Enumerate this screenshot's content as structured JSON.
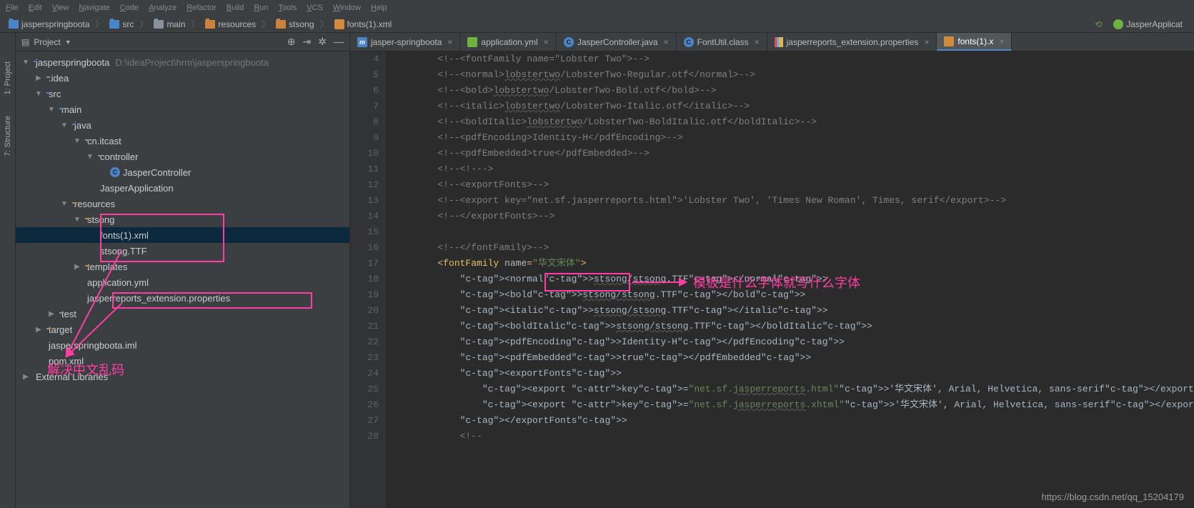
{
  "menu": [
    "File",
    "Edit",
    "View",
    "Navigate",
    "Code",
    "Analyze",
    "Refactor",
    "Build",
    "Run",
    "Tools",
    "VCS",
    "Window",
    "Help"
  ],
  "breadcrumbs": [
    {
      "label": "jasperspringboota",
      "icon": "folder-blue"
    },
    {
      "label": "src",
      "icon": "folder-blue"
    },
    {
      "label": "main",
      "icon": "folder"
    },
    {
      "label": "resources",
      "icon": "folder-orange"
    },
    {
      "label": "stsong",
      "icon": "folder-orange"
    },
    {
      "label": "fonts(1).xml",
      "icon": "xml"
    }
  ],
  "run_config": "JasperApplicat",
  "left_rail": [
    "1: Project",
    "7: Structure"
  ],
  "project_panel_title": "Project",
  "tree": [
    {
      "depth": 0,
      "exp": "▼",
      "icon": "folder-blue",
      "label": "jasperspringboota",
      "muted": "D:\\ideaProject\\hrm\\jasperspringboota"
    },
    {
      "depth": 1,
      "exp": "▶",
      "icon": "folder",
      "label": ".idea"
    },
    {
      "depth": 1,
      "exp": "▼",
      "icon": "folder-blue",
      "label": "src"
    },
    {
      "depth": 2,
      "exp": "▼",
      "icon": "folder-blue",
      "label": "main"
    },
    {
      "depth": 3,
      "exp": "▼",
      "icon": "folder-blue",
      "label": "java"
    },
    {
      "depth": 4,
      "exp": "▼",
      "icon": "folder",
      "label": "cn.itcast"
    },
    {
      "depth": 5,
      "exp": "▼",
      "icon": "folder",
      "label": "controller"
    },
    {
      "depth": 6,
      "exp": "",
      "icon": "class",
      "label": "JasperController"
    },
    {
      "depth": 5,
      "exp": "",
      "icon": "spring",
      "label": "JasperApplication"
    },
    {
      "depth": 3,
      "exp": "▼",
      "icon": "folder-orange",
      "label": "resources"
    },
    {
      "depth": 4,
      "exp": "▼",
      "icon": "folder-orange",
      "label": "stsong",
      "box": "b1"
    },
    {
      "depth": 5,
      "exp": "",
      "icon": "xml",
      "label": "fonts(1).xml",
      "selected": true,
      "box": "b1"
    },
    {
      "depth": 5,
      "exp": "",
      "icon": "file",
      "label": "stsong.TTF",
      "box": "b1"
    },
    {
      "depth": 4,
      "exp": "▶",
      "icon": "folder-orange",
      "label": "templates"
    },
    {
      "depth": 4,
      "exp": "",
      "icon": "yml",
      "label": "application.yml"
    },
    {
      "depth": 4,
      "exp": "",
      "icon": "props",
      "label": "jasperreports_extension.properties",
      "box": "b2"
    },
    {
      "depth": 2,
      "exp": "▶",
      "icon": "folder",
      "label": "test"
    },
    {
      "depth": 1,
      "exp": "▶",
      "icon": "folder-orange",
      "label": "target"
    },
    {
      "depth": 1,
      "exp": "",
      "icon": "iml",
      "label": "jasperspringboota.iml"
    },
    {
      "depth": 1,
      "exp": "",
      "icon": "xml",
      "label": "pom.xml"
    },
    {
      "depth": 0,
      "exp": "▶",
      "icon": "extlib",
      "label": "External Libraries"
    }
  ],
  "tabs": [
    {
      "label": "jasper-springboota",
      "icon": "m",
      "active": false
    },
    {
      "label": "application.yml",
      "icon": "yml",
      "active": false
    },
    {
      "label": "JasperController.java",
      "icon": "class",
      "active": false
    },
    {
      "label": "FontUtil.class",
      "icon": "class",
      "active": false
    },
    {
      "label": "jasperreports_extension.properties",
      "icon": "props",
      "active": false
    },
    {
      "label": "fonts(1).x",
      "icon": "xml",
      "active": true
    }
  ],
  "code_start_line": 4,
  "code_lines": [
    {
      "t": "comment",
      "text": "<!--<fontFamily name=\"Lobster Two\">-->"
    },
    {
      "t": "comment",
      "text": "<!--<normal>lobstertwo/LobsterTwo-Regular.otf</normal>-->",
      "u": "lobstertwo"
    },
    {
      "t": "comment",
      "text": "<!--<bold>lobstertwo/LobsterTwo-Bold.otf</bold>-->",
      "u": "lobstertwo"
    },
    {
      "t": "comment",
      "text": "<!--<italic>lobstertwo/LobsterTwo-Italic.otf</italic>-->",
      "u": "lobstertwo"
    },
    {
      "t": "comment",
      "text": "<!--<boldItalic>lobstertwo/LobsterTwo-BoldItalic.otf</boldItalic>-->",
      "u": "lobstertwo"
    },
    {
      "t": "comment",
      "text": "<!--<pdfEncoding>Identity-H</pdfEncoding>-->"
    },
    {
      "t": "comment",
      "text": "<!--<pdfEmbedded>true</pdfEmbedded>-->"
    },
    {
      "t": "comment",
      "text": "<!--<!--->"
    },
    {
      "t": "comment",
      "text": "<!--<exportFonts>-->"
    },
    {
      "t": "comment",
      "text": "<!--<export key=\"net.sf.jasperreports.html\">'Lobster Two', 'Times New Roman', Times, serif</export>-->"
    },
    {
      "t": "comment",
      "text": "<!--</exportFonts>-->"
    },
    {
      "t": "comment",
      "text": ""
    },
    {
      "t": "comment",
      "text": "<!--</fontFamily>-->"
    },
    {
      "t": "tag",
      "raw": "<fontFamily name=\"华文宋体\">",
      "box": "b3"
    },
    {
      "t": "tag2",
      "raw": "    <normal>stsong/stsong.TTF</normal>",
      "u": "stsong/stsong"
    },
    {
      "t": "tag2",
      "raw": "    <bold>stsong/stsong.TTF</bold>",
      "u": "stsong/stsong"
    },
    {
      "t": "tag2",
      "raw": "    <italic>stsong/stsong.TTF</italic>",
      "u": "stsong/stsong"
    },
    {
      "t": "tag2",
      "raw": "    <boldItalic>stsong/stsong.TTF</boldItalic>",
      "u": "stsong/stsong"
    },
    {
      "t": "tag2",
      "raw": "    <pdfEncoding>Identity-H</pdfEncoding>"
    },
    {
      "t": "tag2",
      "raw": "    <pdfEmbedded>true</pdfEmbedded>"
    },
    {
      "t": "tag2",
      "raw": "    <exportFonts>"
    },
    {
      "t": "tag3",
      "raw": "        <export key=\"net.sf.jasperreports.html\">'华文宋体', Arial, Helvetica, sans-serif</export>",
      "u": "jasperreports"
    },
    {
      "t": "tag3",
      "raw": "        <export key=\"net.sf.jasperreports.xhtml\">'华文宋体', Arial, Helvetica, sans-serif</export>",
      "u": "jasperreports"
    },
    {
      "t": "tag2",
      "raw": "    </exportFonts>"
    },
    {
      "t": "comment",
      "text": "    <!--"
    }
  ],
  "annotations": {
    "a1": "解决中文乱码",
    "a2": "模板是什么字体就写什么字体"
  },
  "watermark": "https://blog.csdn.net/qq_15204179"
}
